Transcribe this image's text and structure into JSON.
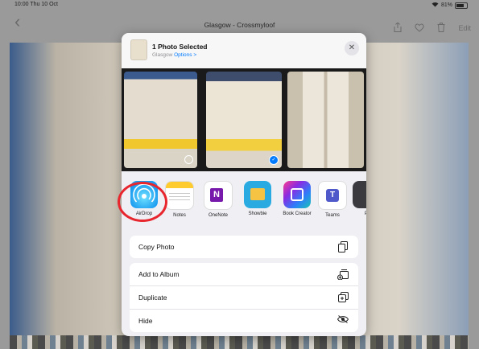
{
  "status": {
    "time": "10:00 Thu 10 Oct",
    "battery": "81%"
  },
  "topbar": {
    "back_icon": "chevron-left-icon",
    "title": "Glasgow - Crossmyloof",
    "edit": "Edit"
  },
  "sheet": {
    "header": {
      "title": "1 Photo Selected",
      "location": "Glasgow",
      "options": "Options >"
    },
    "apps": [
      {
        "label": "AirDrop",
        "icon": "airdrop-icon"
      },
      {
        "label": "Notes",
        "icon": "notes-icon"
      },
      {
        "label": "OneNote",
        "icon": "onenote-icon",
        "glyph": "N"
      },
      {
        "label": "Showbie",
        "icon": "showbie-icon"
      },
      {
        "label": "Book Creator",
        "icon": "book-creator-icon"
      },
      {
        "label": "Teams",
        "icon": "teams-icon",
        "glyph": "T"
      },
      {
        "label": "P",
        "icon": "more-app-icon"
      }
    ],
    "actions_group1": [
      {
        "label": "Copy Photo",
        "icon": "copy-icon"
      }
    ],
    "actions_group2": [
      {
        "label": "Add to Album",
        "icon": "add-album-icon"
      },
      {
        "label": "Duplicate",
        "icon": "duplicate-icon"
      },
      {
        "label": "Hide",
        "icon": "hide-eye-icon"
      }
    ]
  },
  "colors": {
    "accent": "#007aff",
    "highlight_ring": "#e8262e"
  }
}
